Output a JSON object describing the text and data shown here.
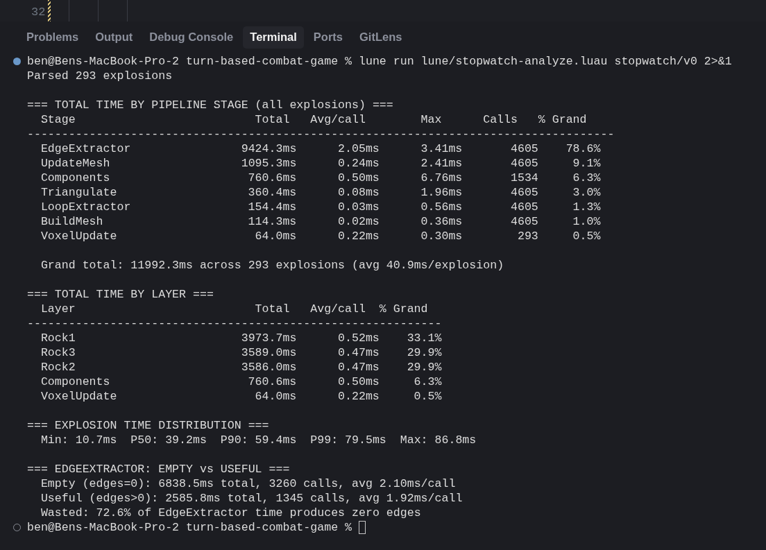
{
  "editor": {
    "line_number": "32",
    "changed": true
  },
  "panel_tabs": [
    {
      "label": "Problems",
      "selected": false
    },
    {
      "label": "Output",
      "selected": false
    },
    {
      "label": "Debug Console",
      "selected": false
    },
    {
      "label": "Terminal",
      "selected": true
    },
    {
      "label": "Ports",
      "selected": false
    },
    {
      "label": "GitLens",
      "selected": false
    }
  ],
  "terminal": {
    "blocks": [
      {
        "kind": "prompt",
        "finished": true,
        "text": "ben@Bens-MacBook-Pro-2 turn-based-combat-game % lune run lune/stopwatch-analyze.luau stopwatch/v0 2>&1",
        "cursor": false
      },
      {
        "kind": "text",
        "text": "Parsed 293 explosions"
      },
      {
        "kind": "blank"
      },
      {
        "kind": "heading",
        "text": "=== TOTAL TIME BY PIPELINE STAGE (all explosions) ==="
      },
      {
        "kind": "table",
        "rule": "-------------------------------------------------------------------------------------",
        "columns": [
          "Stage",
          "Total",
          "Avg/call",
          "Max",
          "Calls",
          "% Grand"
        ],
        "rows": [
          [
            "EdgeExtractor",
            "9424.3ms",
            "2.05ms",
            "3.41ms",
            "4605",
            "78.6%"
          ],
          [
            "UpdateMesh",
            "1095.3ms",
            "0.24ms",
            "2.41ms",
            "4605",
            "9.1%"
          ],
          [
            "Components",
            "760.6ms",
            "0.50ms",
            "6.76ms",
            "1534",
            "6.3%"
          ],
          [
            "Triangulate",
            "360.4ms",
            "0.08ms",
            "1.96ms",
            "4605",
            "3.0%"
          ],
          [
            "LoopExtractor",
            "154.4ms",
            "0.03ms",
            "0.56ms",
            "4605",
            "1.3%"
          ],
          [
            "BuildMesh",
            "114.3ms",
            "0.02ms",
            "0.36ms",
            "4605",
            "1.0%"
          ],
          [
            "VoxelUpdate",
            "64.0ms",
            "0.22ms",
            "0.30ms",
            "293",
            "0.5%"
          ]
        ]
      },
      {
        "kind": "blank"
      },
      {
        "kind": "detail",
        "text": "Grand total: 11992.3ms across 293 explosions (avg 40.9ms/explosion)"
      },
      {
        "kind": "blank"
      },
      {
        "kind": "heading",
        "text": "=== TOTAL TIME BY LAYER ==="
      },
      {
        "kind": "table",
        "rule": "------------------------------------------------------------",
        "columns": [
          "Layer",
          "Total",
          "Avg/call",
          "% Grand"
        ],
        "rows": [
          [
            "Rock1",
            "3973.7ms",
            "0.52ms",
            "33.1%"
          ],
          [
            "Rock3",
            "3589.0ms",
            "0.47ms",
            "29.9%"
          ],
          [
            "Rock2",
            "3586.0ms",
            "0.47ms",
            "29.9%"
          ],
          [
            "Components",
            "760.6ms",
            "0.50ms",
            "6.3%"
          ],
          [
            "VoxelUpdate",
            "64.0ms",
            "0.22ms",
            "0.5%"
          ]
        ]
      },
      {
        "kind": "blank"
      },
      {
        "kind": "heading",
        "text": "=== EXPLOSION TIME DISTRIBUTION ==="
      },
      {
        "kind": "detail",
        "text": "Min: 10.7ms  P50: 39.2ms  P90: 59.4ms  P99: 79.5ms  Max: 86.8ms"
      },
      {
        "kind": "blank"
      },
      {
        "kind": "heading",
        "text": "=== EDGEEXTRACTOR: EMPTY vs USEFUL ==="
      },
      {
        "kind": "detail",
        "text": "Empty (edges=0): 6838.5ms total, 3260 calls, avg 2.10ms/call"
      },
      {
        "kind": "detail",
        "text": "Useful (edges>0): 2585.8ms total, 1345 calls, avg 1.92ms/call"
      },
      {
        "kind": "detail",
        "text": "Wasted: 72.6% of EdgeExtractor time produces zero edges"
      },
      {
        "kind": "prompt",
        "finished": false,
        "text": "ben@Bens-MacBook-Pro-2 turn-based-combat-game %",
        "cursor": true
      }
    ]
  }
}
